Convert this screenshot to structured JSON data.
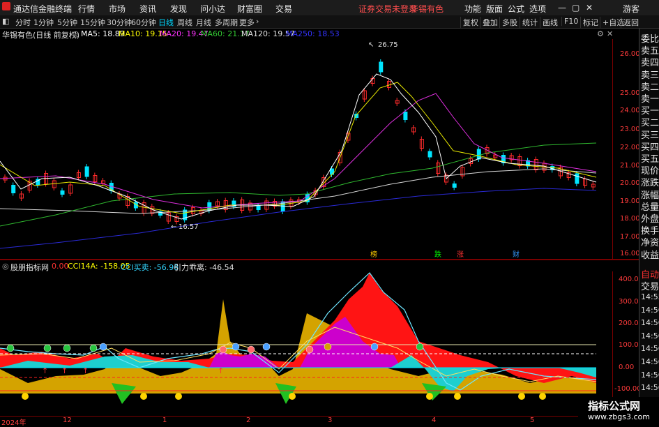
{
  "menu": {
    "app_title": "通达信金融终端",
    "items": [
      "行情",
      "市场",
      "资讯",
      "发现",
      "问小达",
      "财富圈",
      "交易"
    ],
    "notice": "证券交易未登录",
    "stock_name": "华锡有色",
    "right_items": [
      "功能",
      "版面",
      "公式",
      "选项"
    ],
    "guest": "游客"
  },
  "periods": [
    "分时",
    "1分钟",
    "5分钟",
    "15分钟",
    "30分钟",
    "60分钟",
    "日线",
    "周线",
    "月线",
    "多周期",
    "更多"
  ],
  "active_period": "日线",
  "toolbar": [
    "复权",
    "叠加",
    "多股",
    "统计",
    "画线",
    "F10",
    "标记",
    "+自选",
    "返回"
  ],
  "main": {
    "title": "华锡有色(日线 前复权)",
    "ma": [
      {
        "label": "MA5: 18.89",
        "color": "#ffffff"
      },
      {
        "label": "MA10: 19.15",
        "color": "#ffff00"
      },
      {
        "label": "MA20: 19.47",
        "color": "#ff33ff"
      },
      {
        "label": "MA60: 21.17",
        "color": "#33cc33"
      },
      {
        "label": "MA120: 19.57",
        "color": "#e0e0e0"
      },
      {
        "label": "MA250: 18.53",
        "color": "#3333ff"
      }
    ],
    "high_label": "26.75",
    "low_label": "16.57",
    "y_ticks": [
      "26.00",
      "25.00",
      "24.00",
      "23.00",
      "22.00",
      "21.00",
      "20.00",
      "19.00",
      "18.00",
      "17.00",
      "16.00"
    ],
    "markers": [
      {
        "text": "榜",
        "color": "#ffcc00"
      },
      {
        "text": "跌",
        "color": "#00ff00"
      },
      {
        "text": "涨",
        "color": "#ff3333"
      },
      {
        "text": "财",
        "color": "#3399ff"
      }
    ]
  },
  "indicator": {
    "name": "股朋指标网",
    "value0": "0.00",
    "cci14": "CCI14A: -158.05",
    "cci_buy": "CCI买卖: -56.98",
    "gravity": "引力乖离: -46.54",
    "y_ticks": [
      "400.00",
      "300.00",
      "200.00",
      "100.00",
      "0.00",
      "-100.00"
    ]
  },
  "dates": [
    "2024年",
    "12",
    "1",
    "2",
    "3",
    "4",
    "5"
  ],
  "right_panel": [
    "委比",
    "卖五",
    "卖四",
    "卖三",
    "卖二",
    "卖一",
    "买一",
    "买二",
    "买三",
    "买四",
    "买五",
    "现价",
    "涨跌",
    "涨幅",
    "总量",
    "外盘",
    "换手",
    "净资",
    "收益",
    "自动",
    "交易",
    "14:55",
    "14:56",
    "14:56",
    "14:56",
    "14:56",
    "14:56",
    "14:56",
    "14:56"
  ],
  "watermark": {
    "line1": "指标公式网",
    "line2": "www.zbgs3.com"
  }
}
